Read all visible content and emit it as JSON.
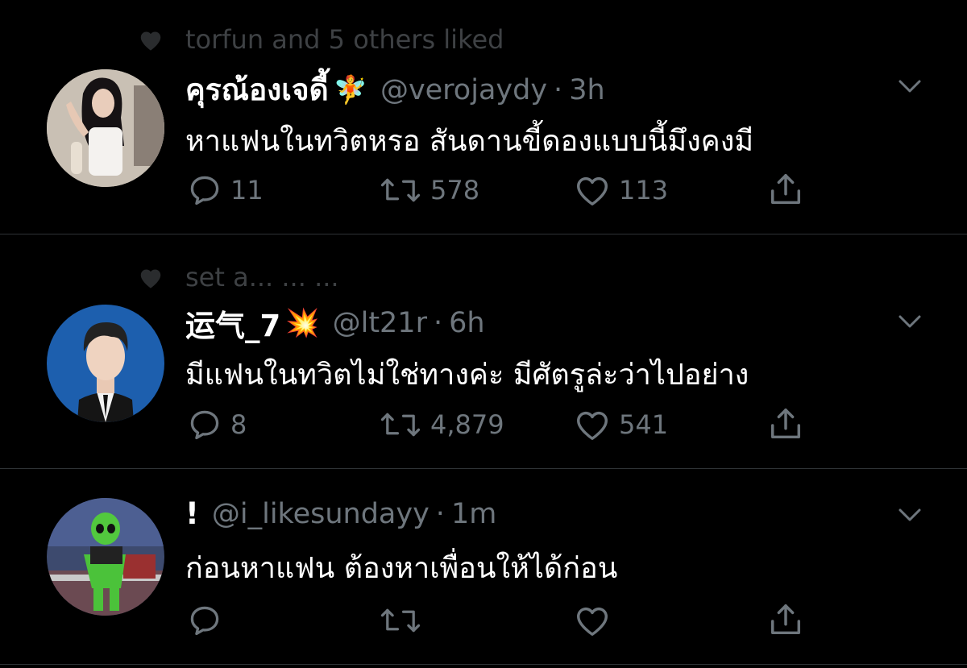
{
  "colors": {
    "background": "#000000",
    "primary_text": "#ffffff",
    "secondary_text": "#6e767d",
    "divider": "#2f3336"
  },
  "tweets": [
    {
      "context": "torfun and 5 others liked",
      "display_name": "คุรณ้องเจดี้",
      "emoji": "🧚",
      "handle": "@verojaydy",
      "separator": "·",
      "time": "3h",
      "text": "หาแฟนในทวิตหรอ สันดานขี้ดองแบบนี้มึงคงมี",
      "reply_count": "11",
      "retweet_count": "578",
      "like_count": "113",
      "icons": [
        "heart-icon",
        "reply-icon",
        "retweet-icon",
        "like-icon",
        "share-icon",
        "chevron-down-icon"
      ]
    },
    {
      "context": "set a... ... ...",
      "display_name": "运气_7",
      "emoji": "💥",
      "handle": "@lt21r",
      "separator": "·",
      "time": "6h",
      "text": "มีแฟนในทวิตไม่ใช่ทางค่ะ มีศัตรูล่ะว่าไปอย่าง",
      "reply_count": "8",
      "retweet_count": "4,879",
      "like_count": "541"
    },
    {
      "display_name": "!",
      "handle": "@i_likesundayy",
      "separator": "·",
      "time": "1m",
      "text": "ก่อนหาแฟน ต้องหาเพื่อนให้ได้ก่อน",
      "reply_count": "",
      "retweet_count": "",
      "like_count": ""
    }
  ]
}
